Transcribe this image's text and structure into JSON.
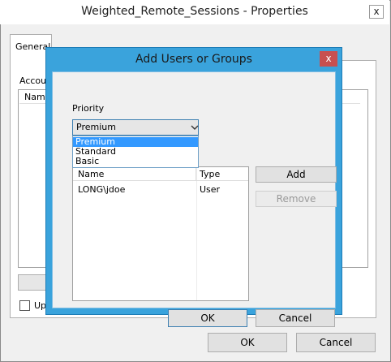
{
  "outer_window": {
    "title": "Weighted_Remote_Sessions - Properties",
    "close_glyph": "x",
    "tab_label": "General",
    "accounts_label": "Accou",
    "list_column_name": "Nam",
    "checkbox_label": "Up",
    "ok_label": "OK",
    "cancel_label": "Cancel"
  },
  "dialog": {
    "title": "Add Users or Groups",
    "close_glyph": "x",
    "priority_label": "Priority",
    "priority_selected": "Premium",
    "priority_options": [
      "Premium",
      "Standard",
      "Basic"
    ],
    "highlighted_option": "Premium",
    "list_columns": [
      "Name",
      "Type"
    ],
    "rows": [
      {
        "name": "LONG\\jdoe",
        "type": "User"
      }
    ],
    "add_label": "Add",
    "remove_label": "Remove",
    "ok_label": "OK",
    "cancel_label": "Cancel",
    "chevron_icon": "chevron-down-icon"
  },
  "colors": {
    "dialog_frame": "#3aa3dc",
    "close_button": "#c75050",
    "selection": "#3399ff"
  }
}
